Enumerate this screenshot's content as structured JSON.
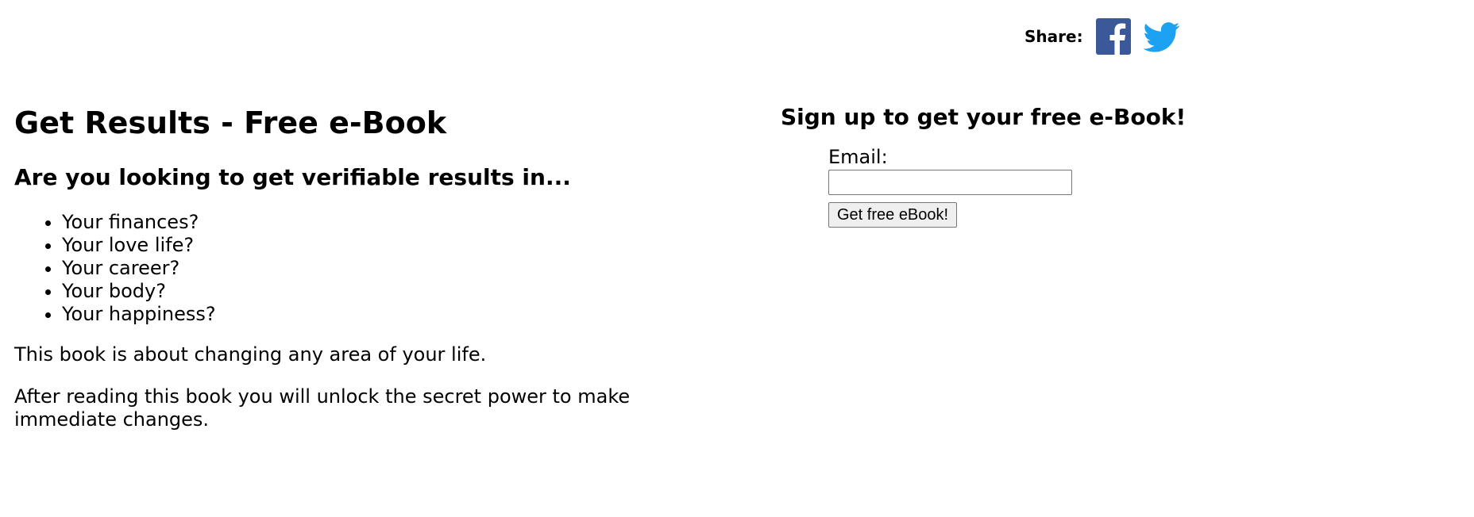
{
  "share": {
    "label": "Share:",
    "facebook_icon": "facebook-icon",
    "twitter_icon": "twitter-icon",
    "facebook_color": "#3b5998",
    "twitter_color": "#1da1f2"
  },
  "main": {
    "title": "Get Results - Free e-Book",
    "subtitle": "Are you looking to get verifiable results in...",
    "bullets": [
      "Your finances?",
      "Your love life?",
      "Your career?",
      "Your body?",
      "Your happiness?"
    ],
    "paragraphs": [
      "This book is about changing any area of your life.",
      "After reading this book you will unlock the secret power to make immediate changes."
    ]
  },
  "signup": {
    "heading": "Sign up to get your free e-Book!",
    "email_label": "Email:",
    "email_value": "",
    "button_label": "Get free eBook!"
  }
}
